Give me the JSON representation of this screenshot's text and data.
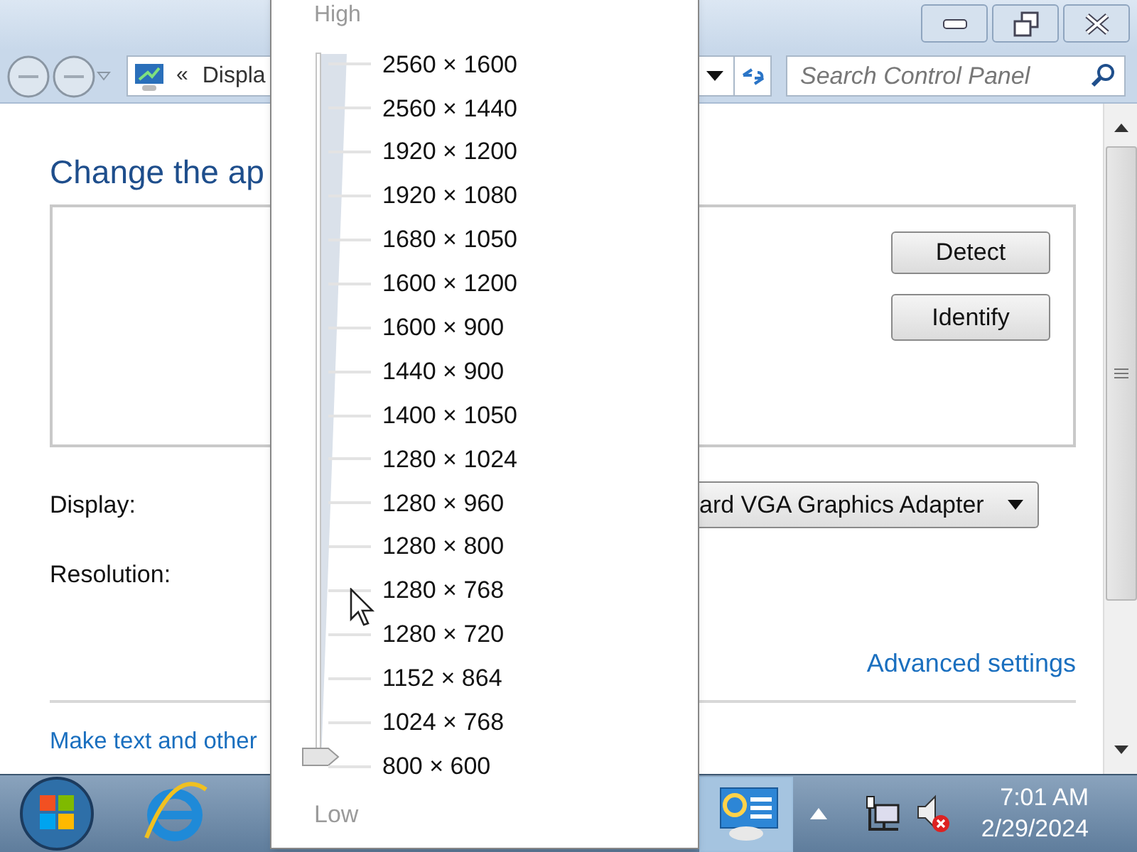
{
  "address_bar": {
    "chevron": "«",
    "path": "Displa"
  },
  "search": {
    "placeholder": "Search Control Panel"
  },
  "content": {
    "title": "Change the ap",
    "buttons": [
      "Detect",
      "Identify"
    ],
    "display_label": "Display:",
    "display_value": "ard VGA Graphics Adapter",
    "resolution_label": "Resolution:",
    "advanced_link": "Advanced settings",
    "bottom_link": "Make text and other"
  },
  "resolution_popup": {
    "high_label": "High",
    "low_label": "Low",
    "level": 0,
    "options": [
      "2560 × 1600",
      "2560 × 1440",
      "1920 × 1200",
      "1920 × 1080",
      "1680 × 1050",
      "1600 × 1200",
      "1600 × 900",
      "1440 × 900",
      "1400 × 1050",
      "1280 × 1024",
      "1280 × 960",
      "1280 × 800",
      "1280 × 768",
      "1280 × 720",
      "1152 × 864",
      "1024 × 768",
      "800 × 600"
    ]
  },
  "taskbar": {
    "time": "7:01 AM",
    "date": "2/29/2024",
    "volume_muted": true
  }
}
